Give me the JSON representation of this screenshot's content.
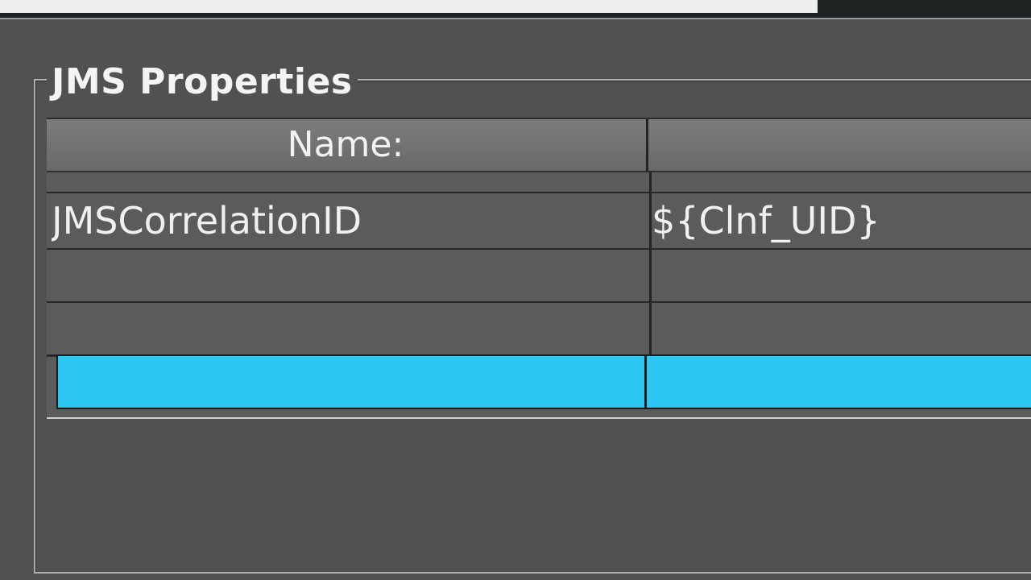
{
  "top_field": {
    "text": ""
  },
  "group": {
    "title": "JMS Properties"
  },
  "table": {
    "columns": [
      {
        "label": "Name:"
      },
      {
        "label": ""
      }
    ],
    "partial_row": {
      "name": "",
      "value": ""
    },
    "rows": [
      {
        "name": "JMSCorrelationID",
        "value": "${Clnf_UID}"
      },
      {
        "name": "",
        "value": ""
      },
      {
        "name": "",
        "value": ""
      },
      {
        "name": "",
        "value": ""
      }
    ]
  },
  "colors": {
    "selection": "#2dc7f4",
    "background": "#4f5251"
  }
}
